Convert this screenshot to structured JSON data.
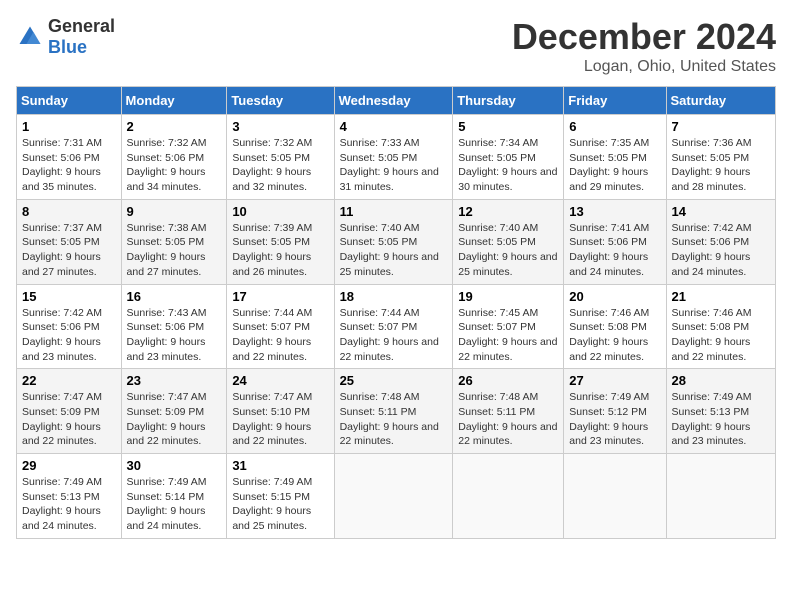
{
  "logo": {
    "general": "General",
    "blue": "Blue"
  },
  "title": {
    "month": "December 2024",
    "location": "Logan, Ohio, United States"
  },
  "weekdays": [
    "Sunday",
    "Monday",
    "Tuesday",
    "Wednesday",
    "Thursday",
    "Friday",
    "Saturday"
  ],
  "weeks": [
    [
      {
        "day": 1,
        "sunrise": "7:31 AM",
        "sunset": "5:06 PM",
        "daylight": "9 hours and 35 minutes."
      },
      {
        "day": 2,
        "sunrise": "7:32 AM",
        "sunset": "5:06 PM",
        "daylight": "9 hours and 34 minutes."
      },
      {
        "day": 3,
        "sunrise": "7:32 AM",
        "sunset": "5:05 PM",
        "daylight": "9 hours and 32 minutes."
      },
      {
        "day": 4,
        "sunrise": "7:33 AM",
        "sunset": "5:05 PM",
        "daylight": "9 hours and 31 minutes."
      },
      {
        "day": 5,
        "sunrise": "7:34 AM",
        "sunset": "5:05 PM",
        "daylight": "9 hours and 30 minutes."
      },
      {
        "day": 6,
        "sunrise": "7:35 AM",
        "sunset": "5:05 PM",
        "daylight": "9 hours and 29 minutes."
      },
      {
        "day": 7,
        "sunrise": "7:36 AM",
        "sunset": "5:05 PM",
        "daylight": "9 hours and 28 minutes."
      }
    ],
    [
      {
        "day": 8,
        "sunrise": "7:37 AM",
        "sunset": "5:05 PM",
        "daylight": "9 hours and 27 minutes."
      },
      {
        "day": 9,
        "sunrise": "7:38 AM",
        "sunset": "5:05 PM",
        "daylight": "9 hours and 27 minutes."
      },
      {
        "day": 10,
        "sunrise": "7:39 AM",
        "sunset": "5:05 PM",
        "daylight": "9 hours and 26 minutes."
      },
      {
        "day": 11,
        "sunrise": "7:40 AM",
        "sunset": "5:05 PM",
        "daylight": "9 hours and 25 minutes."
      },
      {
        "day": 12,
        "sunrise": "7:40 AM",
        "sunset": "5:05 PM",
        "daylight": "9 hours and 25 minutes."
      },
      {
        "day": 13,
        "sunrise": "7:41 AM",
        "sunset": "5:06 PM",
        "daylight": "9 hours and 24 minutes."
      },
      {
        "day": 14,
        "sunrise": "7:42 AM",
        "sunset": "5:06 PM",
        "daylight": "9 hours and 24 minutes."
      }
    ],
    [
      {
        "day": 15,
        "sunrise": "7:42 AM",
        "sunset": "5:06 PM",
        "daylight": "9 hours and 23 minutes."
      },
      {
        "day": 16,
        "sunrise": "7:43 AM",
        "sunset": "5:06 PM",
        "daylight": "9 hours and 23 minutes."
      },
      {
        "day": 17,
        "sunrise": "7:44 AM",
        "sunset": "5:07 PM",
        "daylight": "9 hours and 22 minutes."
      },
      {
        "day": 18,
        "sunrise": "7:44 AM",
        "sunset": "5:07 PM",
        "daylight": "9 hours and 22 minutes."
      },
      {
        "day": 19,
        "sunrise": "7:45 AM",
        "sunset": "5:07 PM",
        "daylight": "9 hours and 22 minutes."
      },
      {
        "day": 20,
        "sunrise": "7:46 AM",
        "sunset": "5:08 PM",
        "daylight": "9 hours and 22 minutes."
      },
      {
        "day": 21,
        "sunrise": "7:46 AM",
        "sunset": "5:08 PM",
        "daylight": "9 hours and 22 minutes."
      }
    ],
    [
      {
        "day": 22,
        "sunrise": "7:47 AM",
        "sunset": "5:09 PM",
        "daylight": "9 hours and 22 minutes."
      },
      {
        "day": 23,
        "sunrise": "7:47 AM",
        "sunset": "5:09 PM",
        "daylight": "9 hours and 22 minutes."
      },
      {
        "day": 24,
        "sunrise": "7:47 AM",
        "sunset": "5:10 PM",
        "daylight": "9 hours and 22 minutes."
      },
      {
        "day": 25,
        "sunrise": "7:48 AM",
        "sunset": "5:11 PM",
        "daylight": "9 hours and 22 minutes."
      },
      {
        "day": 26,
        "sunrise": "7:48 AM",
        "sunset": "5:11 PM",
        "daylight": "9 hours and 22 minutes."
      },
      {
        "day": 27,
        "sunrise": "7:49 AM",
        "sunset": "5:12 PM",
        "daylight": "9 hours and 23 minutes."
      },
      {
        "day": 28,
        "sunrise": "7:49 AM",
        "sunset": "5:13 PM",
        "daylight": "9 hours and 23 minutes."
      }
    ],
    [
      {
        "day": 29,
        "sunrise": "7:49 AM",
        "sunset": "5:13 PM",
        "daylight": "9 hours and 24 minutes."
      },
      {
        "day": 30,
        "sunrise": "7:49 AM",
        "sunset": "5:14 PM",
        "daylight": "9 hours and 24 minutes."
      },
      {
        "day": 31,
        "sunrise": "7:49 AM",
        "sunset": "5:15 PM",
        "daylight": "9 hours and 25 minutes."
      },
      null,
      null,
      null,
      null
    ]
  ]
}
